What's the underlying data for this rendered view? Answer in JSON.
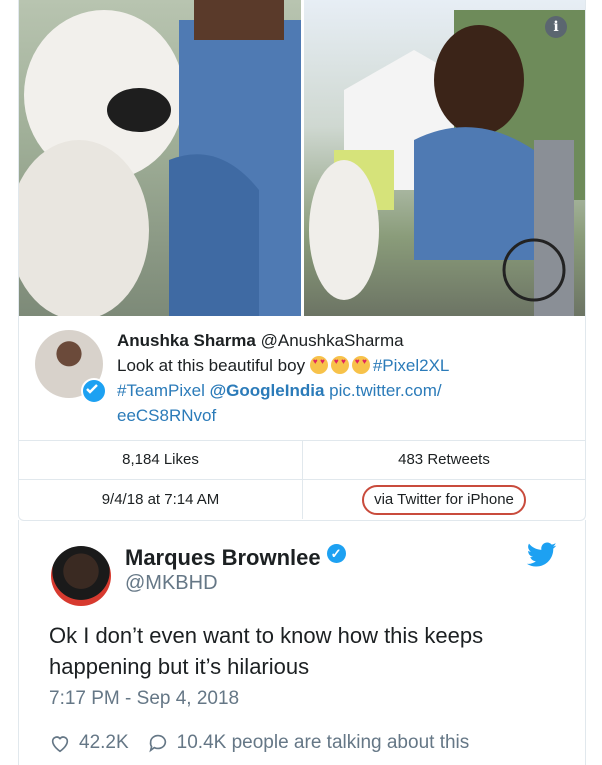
{
  "quoted_card": {
    "info_icon": "info-icon",
    "author_name": "Anushka Sharma",
    "author_handle": "@AnushkaSharma",
    "text_part1": "Look at this beautiful boy",
    "hashtag1": "#Pixel2XL",
    "hashtag2": "#TeamPixel",
    "mention": "@GoogleIndia",
    "link_part1": "pic.twitter.com/",
    "link_part2": "eeCS8RNvof",
    "likes": "8,184 Likes",
    "retweets": "483 Retweets",
    "date": "9/4/18 at 7:14 AM",
    "source": "via Twitter for iPhone"
  },
  "tweet": {
    "name": "Marques Brownlee",
    "handle": "@MKBHD",
    "body": "Ok I don’t even want to know how this keeps happening but it’s hilarious",
    "time": "7:17 PM - Sep 4, 2018",
    "likes": "42.2K",
    "replies_text": "10.4K people are talking about this"
  },
  "colors": {
    "link": "#2b7bb9",
    "twitter_blue": "#1da1f2",
    "highlight_oval": "#c94b3c"
  }
}
